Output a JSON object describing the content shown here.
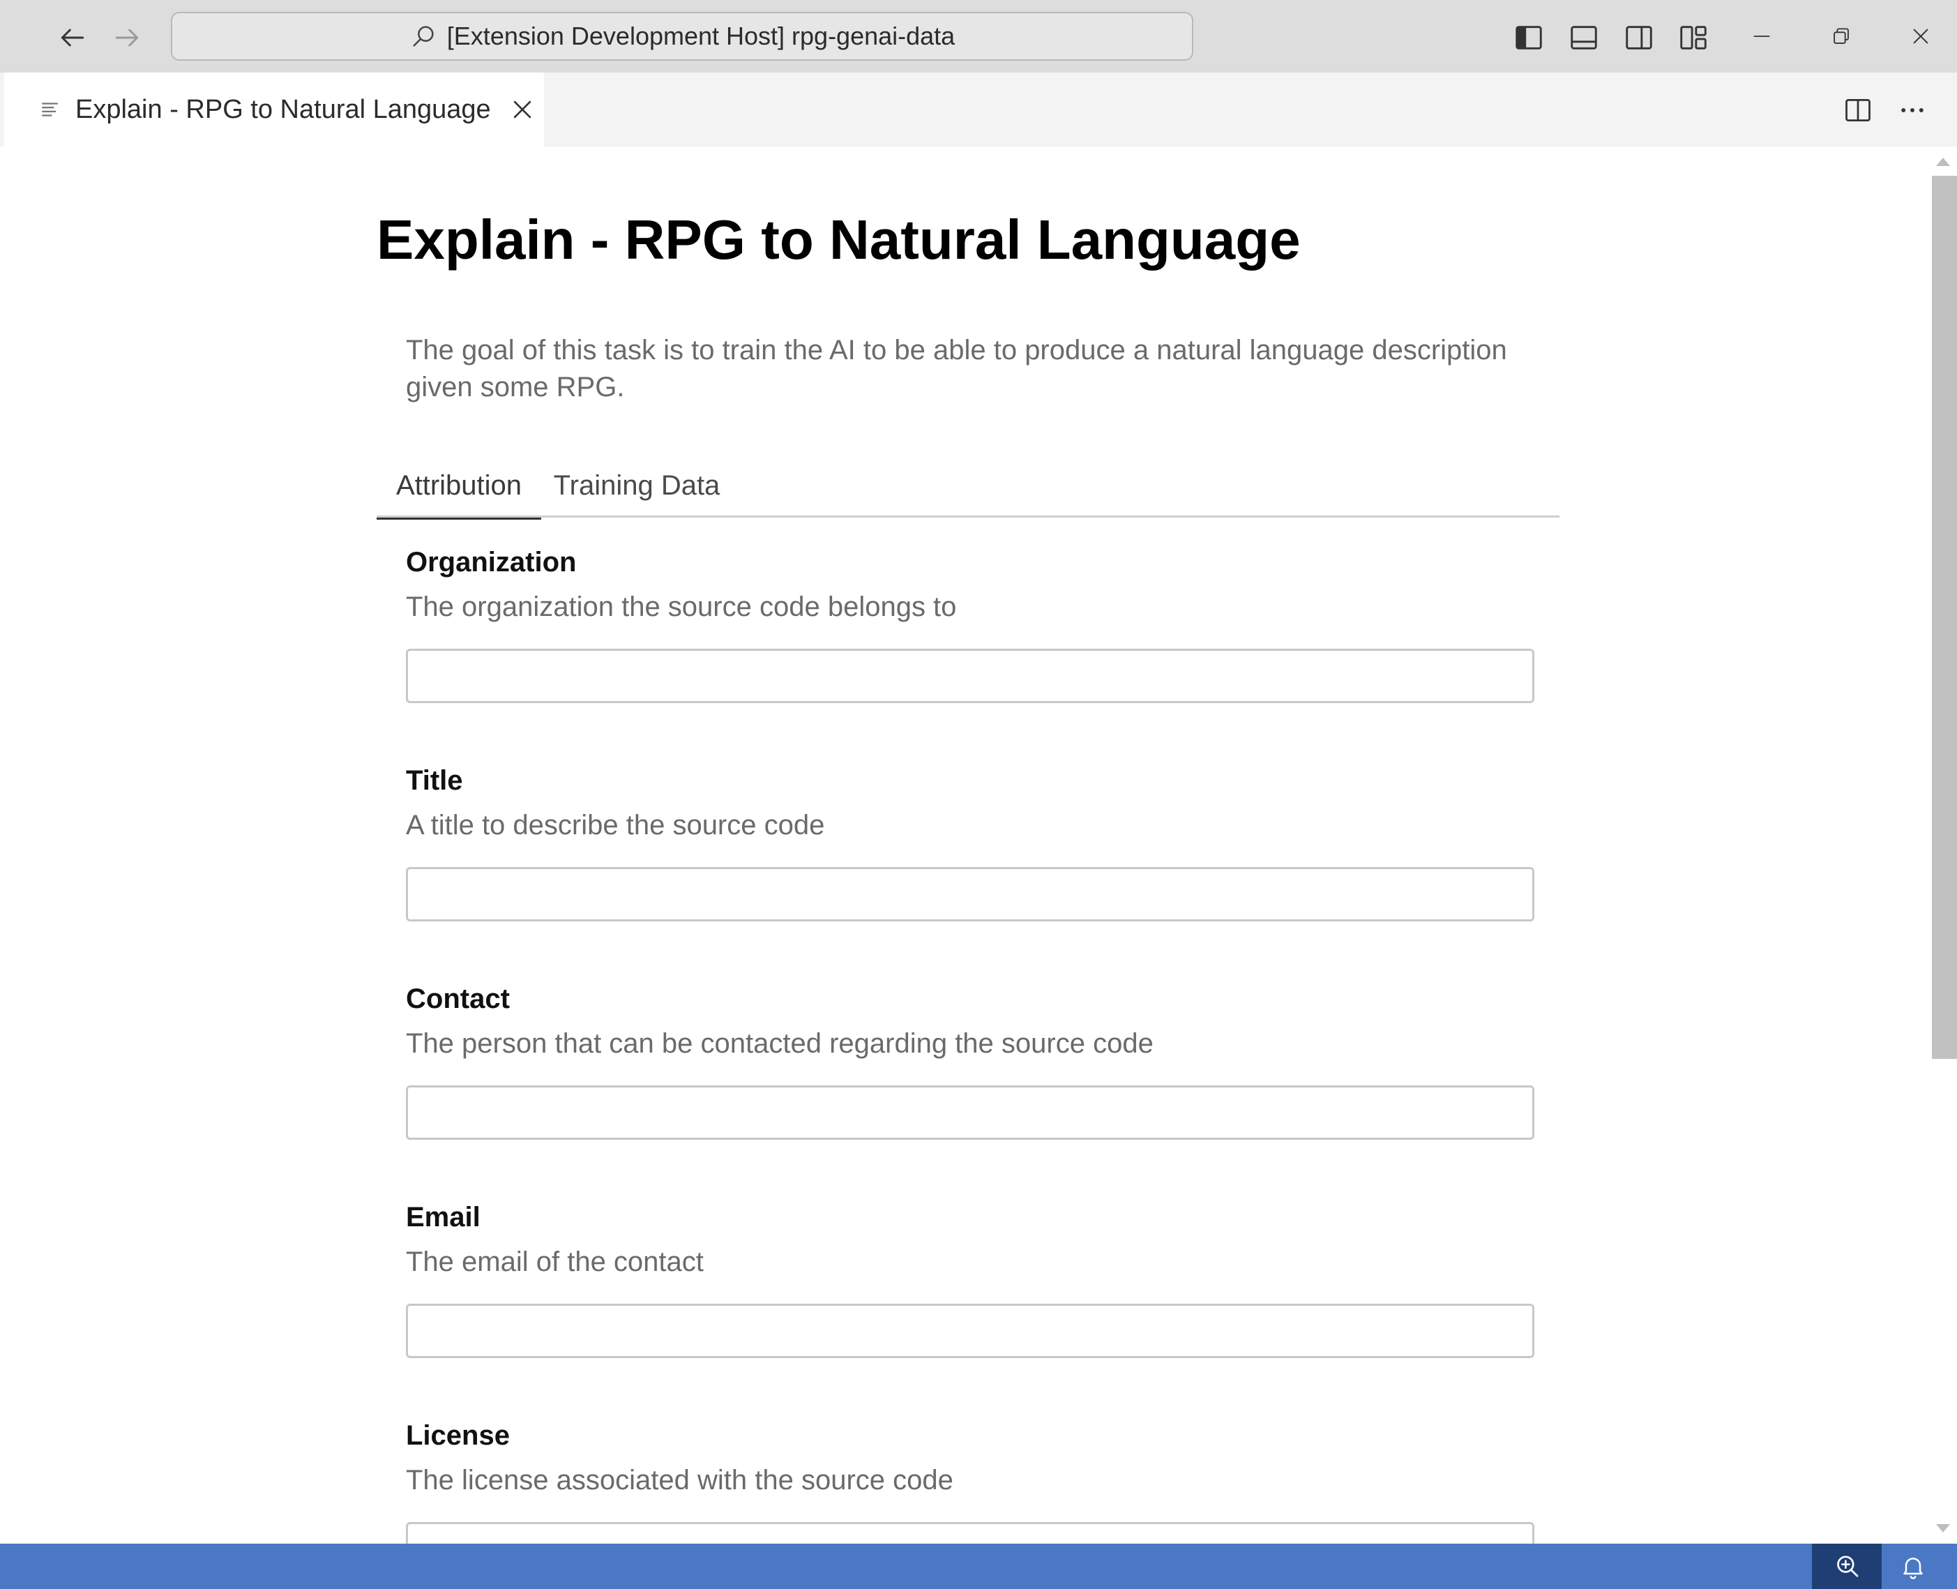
{
  "window": {
    "title": "[Extension Development Host] rpg-genai-data"
  },
  "editor_tab": {
    "label": "Explain - RPG to Natural Language"
  },
  "page": {
    "title": "Explain - RPG to Natural Language",
    "description": "The goal of this task is to train the AI to be able to produce a natural language description given some RPG."
  },
  "tabs": [
    {
      "label": "Attribution",
      "active": true
    },
    {
      "label": "Training Data",
      "active": false
    }
  ],
  "fields": [
    {
      "label": "Organization",
      "help": "The organization the source code belongs to",
      "value": ""
    },
    {
      "label": "Title",
      "help": "A title to describe the source code",
      "value": ""
    },
    {
      "label": "Contact",
      "help": "The person that can be contacted regarding the source code",
      "value": ""
    },
    {
      "label": "Email",
      "help": "The email of the contact",
      "value": ""
    },
    {
      "label": "License",
      "help": "The license associated with the source code",
      "value": ""
    }
  ],
  "colors": {
    "status_bar": "#4a78c4",
    "status_bar_item": "#1f3f74",
    "title_bar": "#dddddd"
  },
  "icons": {
    "back": "arrow-left-icon",
    "forward": "arrow-right-icon",
    "search": "search-icon",
    "zoom": "zoom-in-icon",
    "notifications": "bell-icon"
  }
}
